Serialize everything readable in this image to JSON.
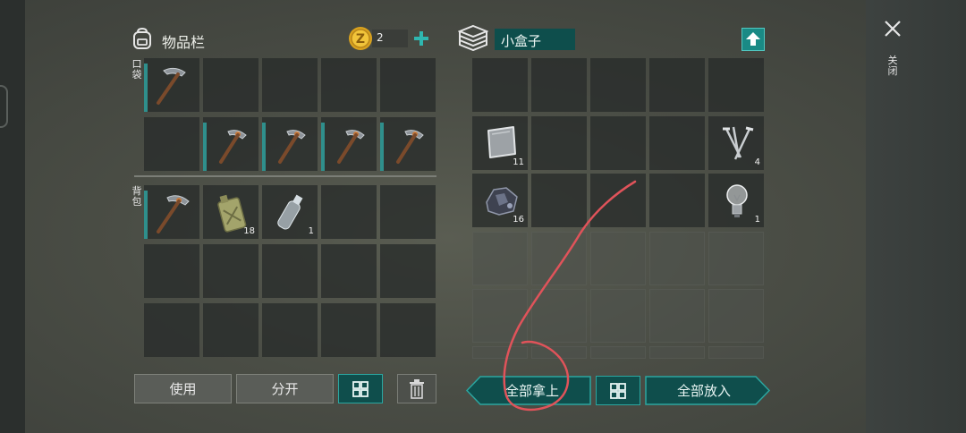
{
  "inventory": {
    "title": "物品栏",
    "coins": "2",
    "pocket_label": "口袋",
    "backpack_label": "背包",
    "slots": {
      "backpack_can_qty": "18",
      "backpack_bottle_qty": "1"
    }
  },
  "container": {
    "name": "小盒子",
    "slots": {
      "metal_plate_qty": "11",
      "nails_qty": "4",
      "ore_qty": "16",
      "bulb_qty": "1"
    }
  },
  "buttons": {
    "use": "使用",
    "split": "分开",
    "take_all": "全部拿上",
    "put_all": "全部放入"
  },
  "close_label": "关闭",
  "colors": {
    "accent": "#2ba6a0",
    "teal_dark": "#0f4e4c",
    "annotation": "#e0535a"
  }
}
